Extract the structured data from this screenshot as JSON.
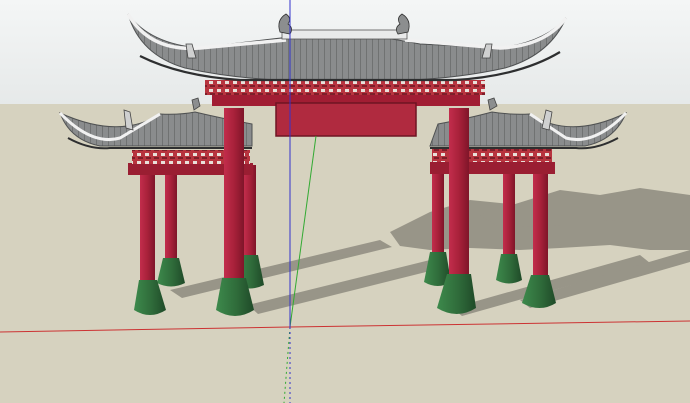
{
  "scene": {
    "sky_color": "#eef0f0",
    "ground_color": "#d6d2bf",
    "shadow_color": "#8e8b7f",
    "axis_colors": {
      "red": "#cc3333",
      "green": "#33aa33",
      "blue": "#3333cc"
    },
    "model": {
      "object": "chinese-memorial-archway",
      "pillar_color": "#a8213a",
      "pillar_base_color": "#2f6b3a",
      "roof_tile_color": "#7d7f80",
      "roof_ridge_color": "#f1f1f1",
      "bracket_color": "#b7343f"
    }
  }
}
